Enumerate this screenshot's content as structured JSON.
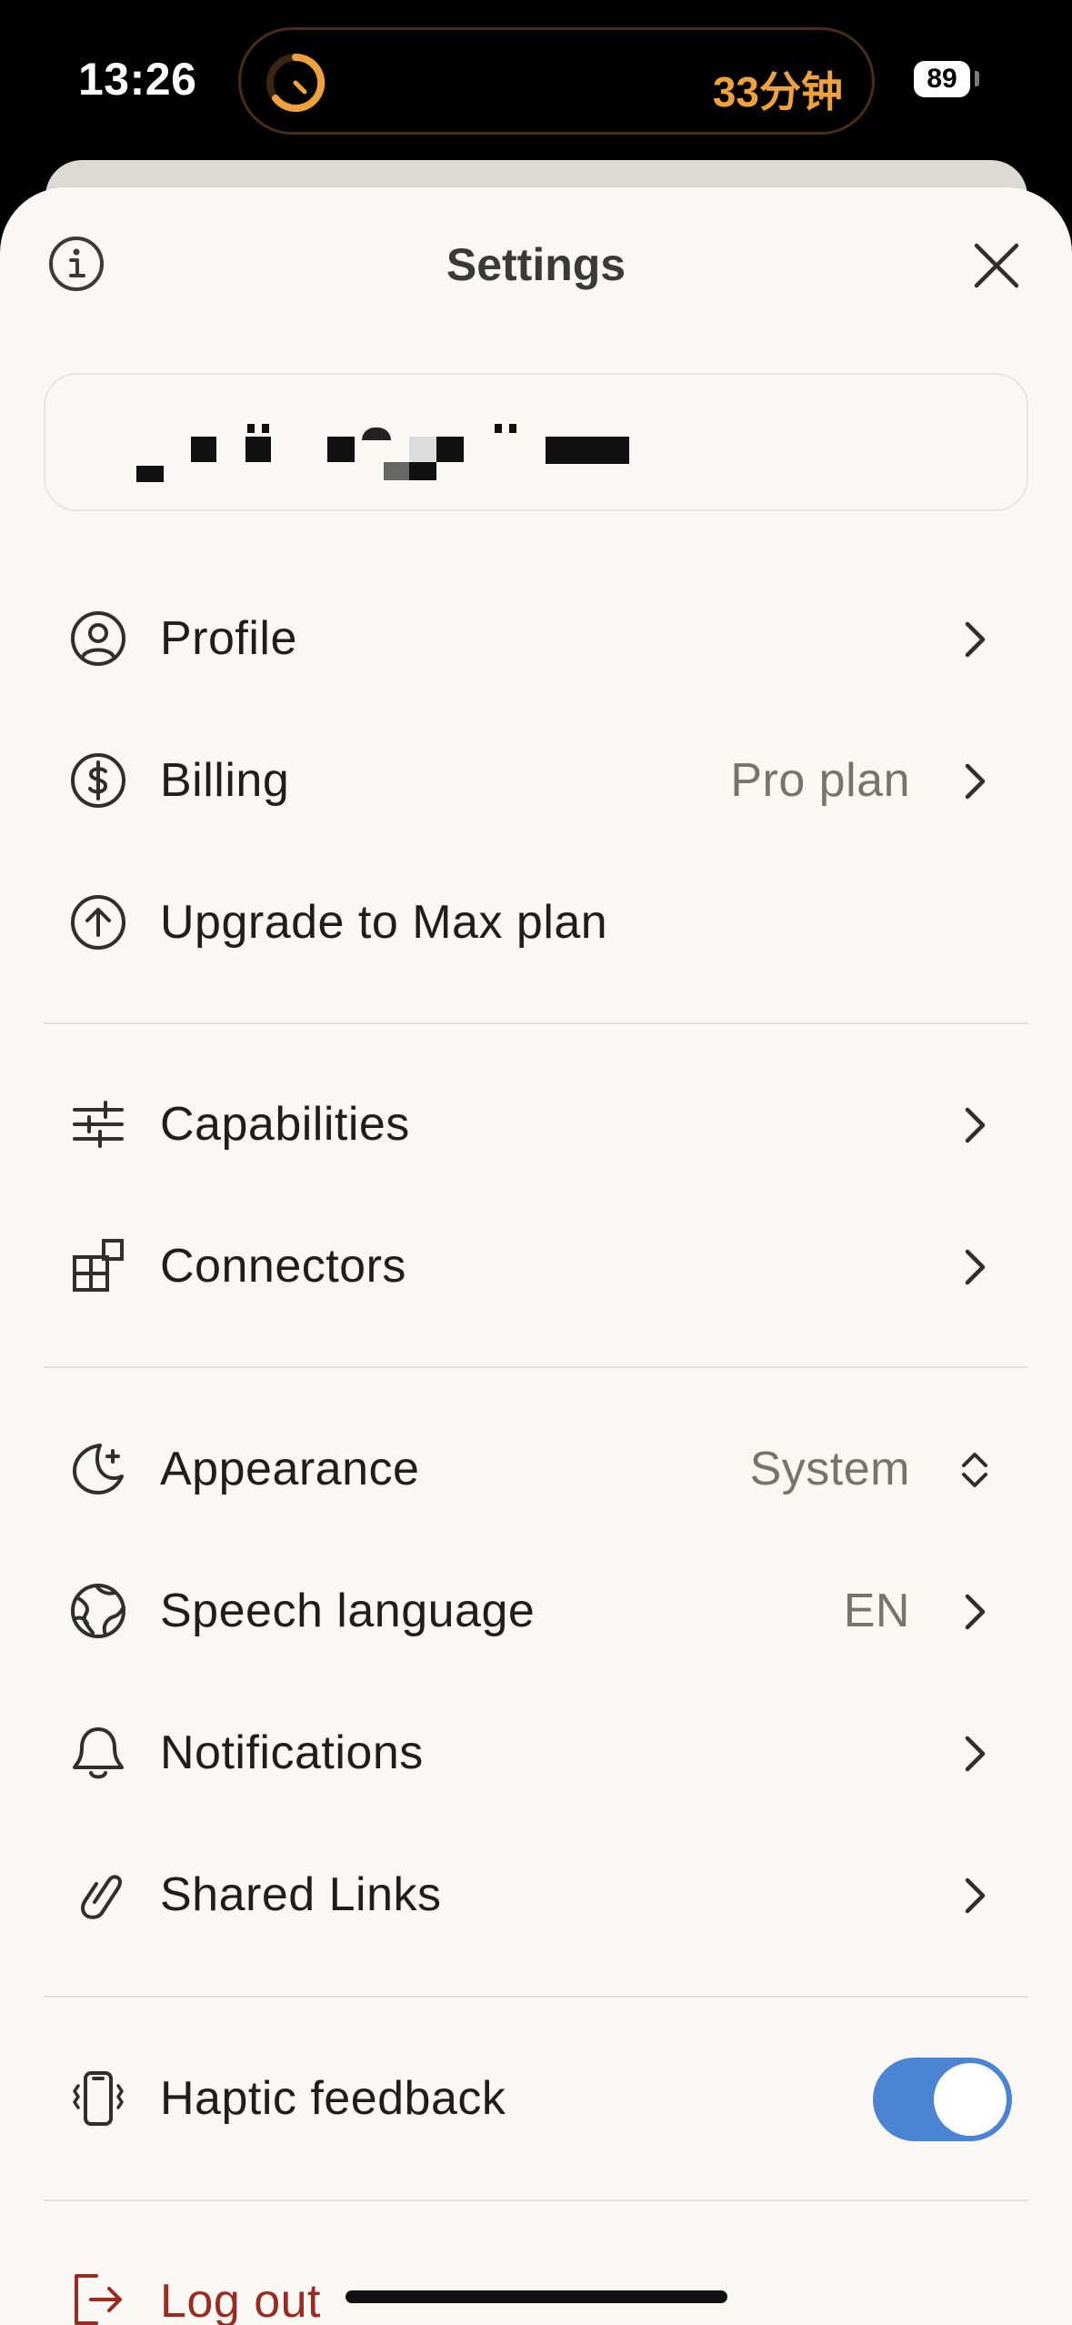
{
  "status_bar": {
    "time": "13:26",
    "activity_text": "33分钟",
    "battery": "89"
  },
  "header": {
    "title": "Settings",
    "info_icon": "info-icon",
    "close_icon": "close-icon"
  },
  "account": {
    "email_redacted": true
  },
  "section_account": [
    {
      "label": "Profile",
      "icon": "user-circle-icon",
      "value": "",
      "chevron": true
    },
    {
      "label": "Billing",
      "icon": "dollar-circle-icon",
      "value": "Pro plan",
      "chevron": true
    },
    {
      "label": "Upgrade to Max plan",
      "icon": "arrow-up-circle-icon",
      "value": "",
      "chevron": false
    }
  ],
  "section_features": [
    {
      "label": "Capabilities",
      "icon": "sliders-icon",
      "chevron": true
    },
    {
      "label": "Connectors",
      "icon": "blocks-icon",
      "chevron": true
    }
  ],
  "section_prefs": [
    {
      "label": "Appearance",
      "icon": "moon-icon",
      "value": "System",
      "control": "updown"
    },
    {
      "label": "Speech language",
      "icon": "globe-icon",
      "value": "EN",
      "control": "chevron"
    },
    {
      "label": "Notifications",
      "icon": "bell-icon",
      "value": "",
      "control": "chevron"
    },
    {
      "label": "Shared Links",
      "icon": "link-icon",
      "value": "",
      "control": "chevron"
    }
  ],
  "haptic": {
    "label": "Haptic feedback",
    "icon": "vibrate-phone-icon",
    "enabled": true
  },
  "logout": {
    "label": "Log out",
    "icon": "logout-icon"
  },
  "colors": {
    "sheet_bg": "#f9f8f5",
    "toggle_on": "#4a84d2",
    "logout": "#9b2a20",
    "activity": "#f0a23a"
  }
}
